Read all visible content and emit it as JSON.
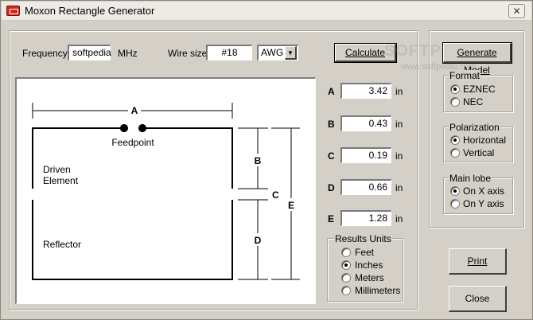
{
  "window": {
    "title": "Moxon Rectangle Generator",
    "close_glyph": "✕"
  },
  "frequency": {
    "label": "Frequency",
    "value": "softpedia",
    "unit": "MHz"
  },
  "wire": {
    "label": "Wire size",
    "value": "#18",
    "gauge_selected": "AWG",
    "dropdown_glyph": "▼"
  },
  "buttons": {
    "calculate": "Calculate",
    "generate": "Generate Model",
    "print": "Print",
    "close": "Close"
  },
  "watermark": {
    "main": "SOFTPEDIA",
    "sub": "www.softpedia.com"
  },
  "diagram": {
    "label_a": "A",
    "label_b": "B",
    "label_c": "C",
    "label_d": "D",
    "label_e": "E",
    "feedpoint": "Feedpoint",
    "driven_line1": "Driven",
    "driven_line2": "Element",
    "reflector": "Reflector"
  },
  "results": [
    {
      "label": "A",
      "value": "3.42",
      "unit": "in"
    },
    {
      "label": "B",
      "value": "0.43",
      "unit": "in"
    },
    {
      "label": "C",
      "value": "0.19",
      "unit": "in"
    },
    {
      "label": "D",
      "value": "0.66",
      "unit": "in"
    },
    {
      "label": "E",
      "value": "1.28",
      "unit": "in"
    }
  ],
  "units_group": {
    "title": "Results Units",
    "options": [
      {
        "label": "Feet",
        "selected": false
      },
      {
        "label": "Inches",
        "selected": true
      },
      {
        "label": "Meters",
        "selected": false
      },
      {
        "label": "Millimeters",
        "selected": false
      }
    ]
  },
  "format_group": {
    "title": "Format",
    "options": [
      {
        "label": "EZNEC",
        "selected": true
      },
      {
        "label": "NEC",
        "selected": false
      }
    ]
  },
  "polarization_group": {
    "title": "Polarization",
    "options": [
      {
        "label": "Horizontal",
        "selected": true
      },
      {
        "label": "Vertical",
        "selected": false
      }
    ]
  },
  "mainlobe_group": {
    "title": "Main lobe",
    "options": [
      {
        "label": "On X axis",
        "selected": true
      },
      {
        "label": "On Y axis",
        "selected": false
      }
    ]
  }
}
